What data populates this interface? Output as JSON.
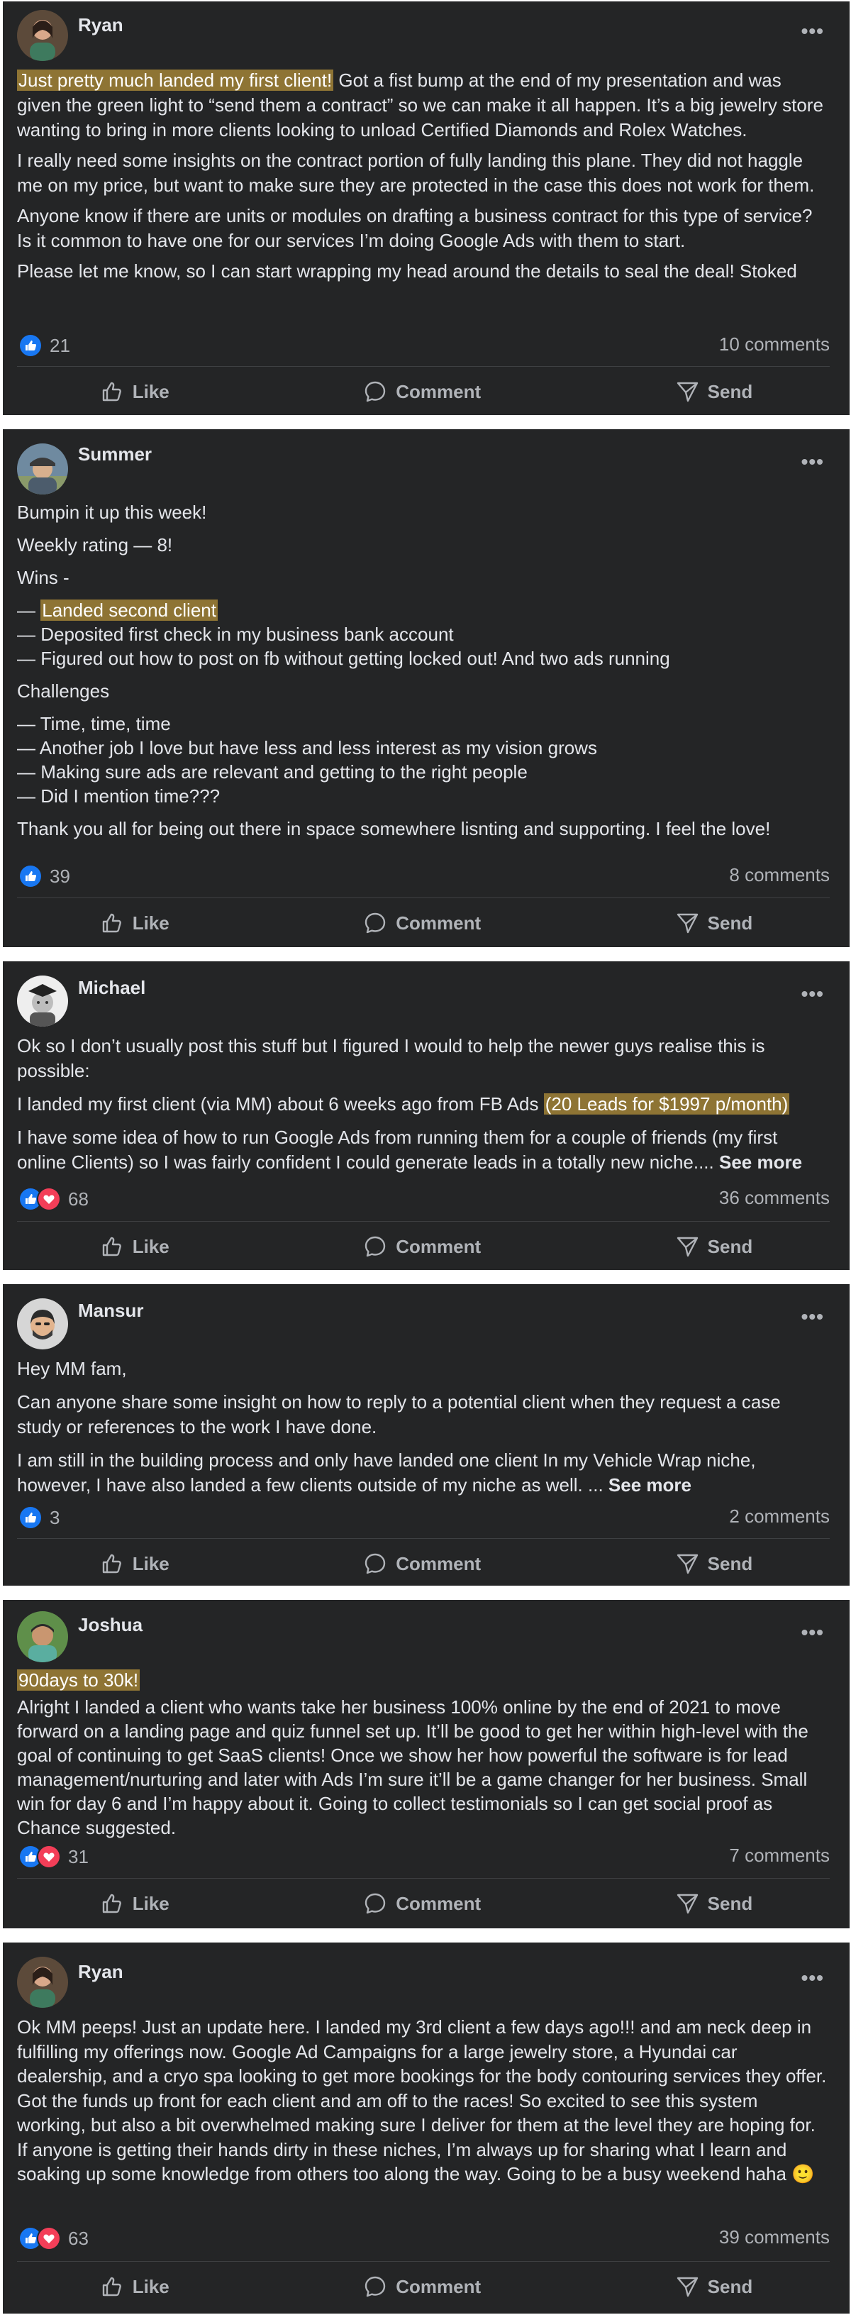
{
  "posts": [
    {
      "author": "Ryan",
      "paragraphs": {
        "p1_highlight": "Just pretty much landed my first client!",
        "p1_rest": " Got a fist bump at the end of my presentation and was given the green light to “send them a contract” so we can make it all happen. It’s a big jewelry store wanting to bring in more clients looking to unload Certified Diamonds and Rolex Watches.",
        "p2": "I really need some insights on the contract portion of fully landing this plane. They did not haggle me on my price, but want to make sure they are protected in the case this does not work for them.",
        "p3": "Anyone know if there are units or modules on drafting a business contract for this type of service? Is it common to have one for our services I’m doing Google Ads with them to start.",
        "p4": "Please let me know, so I can start wrapping my head around the details to seal the deal! Stoked"
      },
      "reactions": "21",
      "comments": "10 comments"
    },
    {
      "author": "Summer",
      "lines": {
        "l1": "Bumpin it up this week!",
        "l2": "Weekly rating — 8!",
        "l3": "Wins -",
        "w1_prefix": "— ",
        "w1_highlight": "Landed second client",
        "w2": "— Deposited first check in my business bank account",
        "w3": "— Figured out how to post on fb without getting locked out! And two ads running",
        "challenges": "Challenges",
        "c1": "— Time, time, time",
        "c2": "— Another job I love but have less and less interest as my vision grows",
        "c3": "— Making sure ads are relevant and getting to the right people",
        "c4": "— Did I mention time???",
        "closing": "Thank you all for being out there in space somewhere lisnting and supporting. I feel the love!"
      },
      "reactions": "39",
      "comments": "8 comments"
    },
    {
      "author": "Michael",
      "paragraphs": {
        "p1": "Ok so I don’t usually post this stuff but I figured I would to help the newer guys realise this is possible:",
        "p2_text": "I landed my first client (via MM) about 6 weeks ago from FB Ads ",
        "p2_highlight": "(20 Leads for $1997 p/month)",
        "p3": "I have some idea of how to run Google Ads from running them for a couple of friends (my first online Clients) so I was fairly confident I could generate leads in a totally new niche.... ",
        "see_more": "See more"
      },
      "reactions": "68",
      "comments": "36 comments"
    },
    {
      "author": "Mansur",
      "paragraphs": {
        "p1": "Hey MM fam,",
        "p2": "Can anyone share some insight on how to reply to a potential client when they request a case study or references to the work I have done.",
        "p3": "I am still in the building process and only have landed one client In my Vehicle Wrap niche, however, I have also landed a few clients outside of my niche as well. ... ",
        "see_more": "See more"
      },
      "reactions": "3",
      "comments": "2 comments"
    },
    {
      "author": "Joshua",
      "paragraphs": {
        "p1_highlight": "90days to 30k!",
        "p2": "Alright I landed a client who wants take her business 100% online by the end of 2021 to move forward on a landing page and quiz funnel set up. It’ll be good to get her within high-level with the goal of continuing to get SaaS clients! Once we show her how powerful the software is for lead management/nurturing and later with Ads I’m sure it’ll be a game changer for her business. Small win for day 6 and I’m happy about it. Going to collect testimonials so I can get social proof as Chance suggested."
      },
      "reactions": "31",
      "comments": "7 comments"
    },
    {
      "author": "Ryan",
      "paragraphs": {
        "p1": "Ok MM peeps! Just an update here. I landed my 3rd client a few days ago!!! and am neck deep in fulfilling my offerings now. Google Ad Campaigns for a large jewelry store, a Hyundai car dealership, and a cryo spa looking to get more bookings for the body contouring services they offer. Got the funds up front for each client and am off to the races! So excited to see this system working, but also a bit overwhelmed making sure I deliver for them at the level they are hoping for. If anyone is getting their hands dirty in these niches, I’m always up for sharing what I learn and soaking up some knowledge from others too along the way. Going to be a busy weekend haha 🙂"
      },
      "reactions": "63",
      "comments": "39 comments"
    }
  ],
  "actions": {
    "like": "Like",
    "comment": "Comment",
    "send": "Send"
  },
  "more_glyph": "•••",
  "colors": {
    "card_bg": "#242526",
    "highlight": "#8e7434",
    "like_blue": "#1877f2",
    "love_red": "#f33e58"
  }
}
